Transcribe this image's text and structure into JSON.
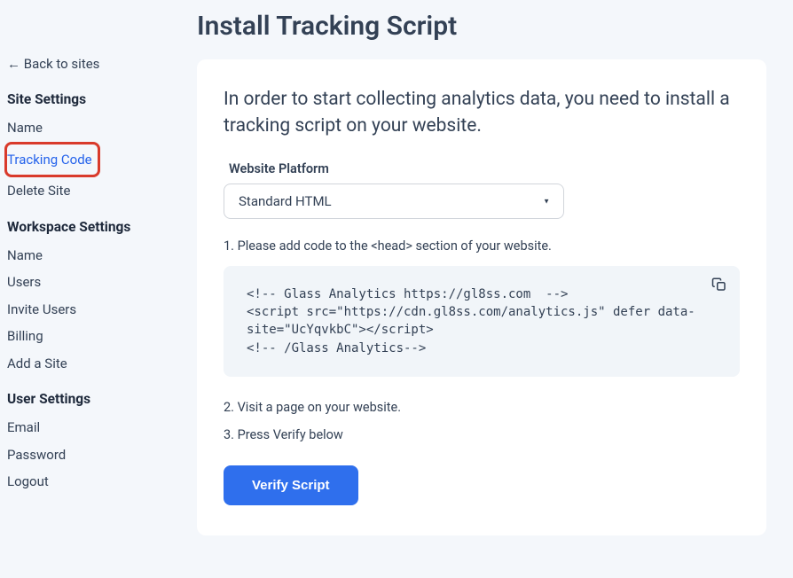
{
  "sidebar": {
    "back_label": "← Back to sites",
    "sections": {
      "site": {
        "heading": "Site Settings",
        "items": {
          "name": "Name",
          "tracking_code": "Tracking Code",
          "delete_site": "Delete Site"
        }
      },
      "workspace": {
        "heading": "Workspace Settings",
        "items": {
          "name": "Name",
          "users": "Users",
          "invite_users": "Invite Users",
          "billing": "Billing",
          "add_site": "Add a Site"
        }
      },
      "user": {
        "heading": "User Settings",
        "items": {
          "email": "Email",
          "password": "Password",
          "logout": "Logout"
        }
      }
    }
  },
  "main": {
    "title": "Install Tracking Script",
    "intro": "In order to start collecting analytics data, you need to install a tracking script on your website.",
    "platform_label": "Website Platform",
    "platform_selected": "Standard HTML",
    "step1": "1. Please add code to the <head> section of your website.",
    "code_snippet": "<!-- Glass Analytics https://gl8ss.com  -->\n<script src=\"https://cdn.gl8ss.com/analytics.js\" defer data-site=\"UcYqvkbC\"></script>\n<!-- /Glass Analytics-->",
    "step2": "2. Visit a page on your website.",
    "step3": "3. Press Verify below",
    "verify_label": "Verify Script"
  }
}
